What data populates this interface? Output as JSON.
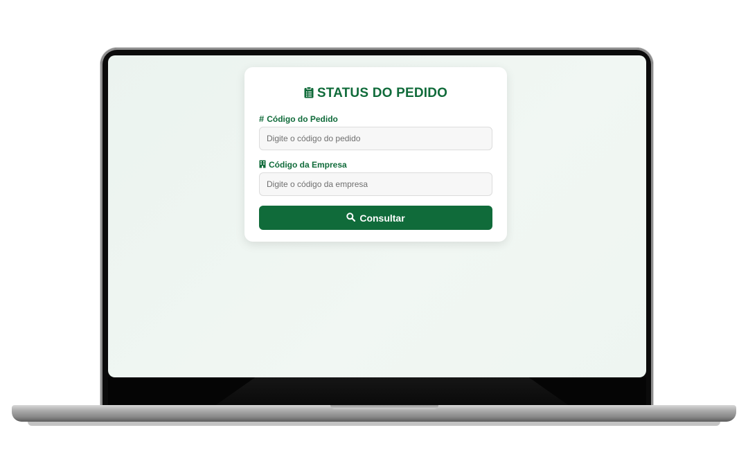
{
  "card": {
    "title": "STATUS DO PEDIDO",
    "title_icon": "clipboard-list-icon"
  },
  "form": {
    "order_code": {
      "label": "Código do Pedido",
      "icon": "hashtag-icon",
      "placeholder": "Digite o código do pedido",
      "value": ""
    },
    "company_code": {
      "label": "Código da Empresa",
      "icon": "building-icon",
      "placeholder": "Digite o código da empresa",
      "value": ""
    },
    "submit": {
      "label": "Consultar",
      "icon": "search-icon"
    }
  },
  "colors": {
    "brand_green": "#106b3a",
    "screen_background": "#ebf3ef",
    "input_background": "#f7f7f7"
  }
}
